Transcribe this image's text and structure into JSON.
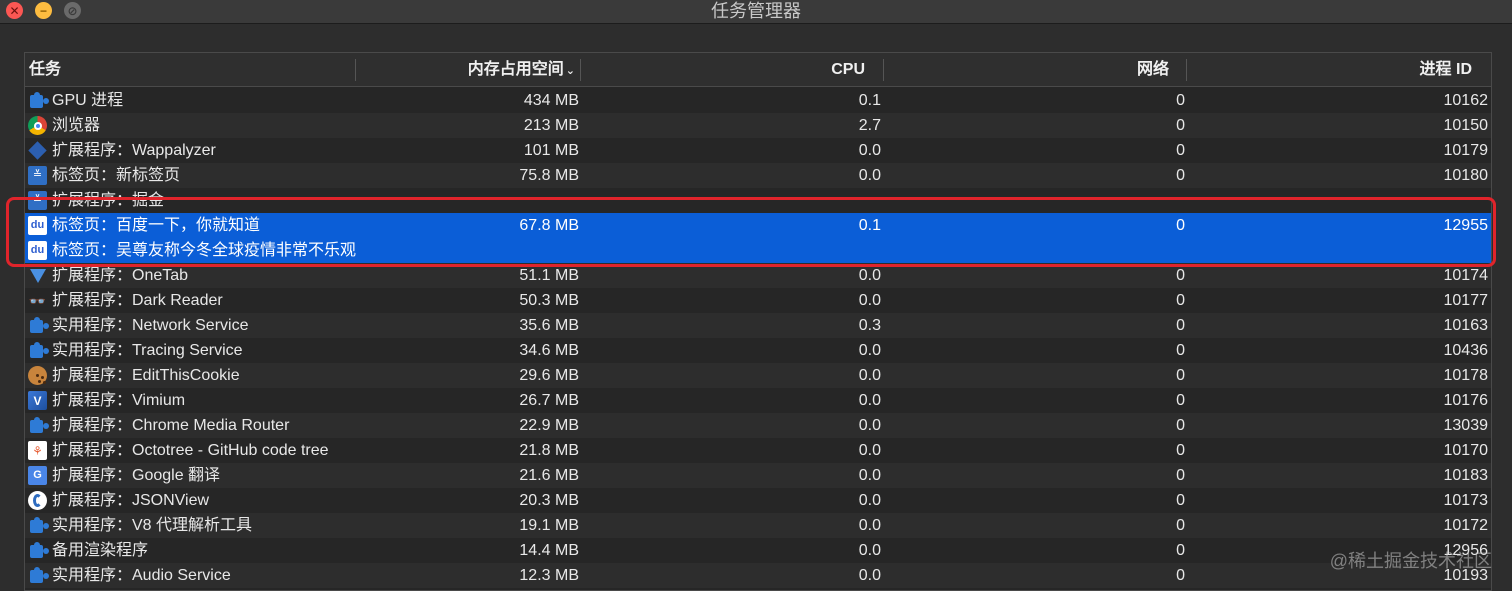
{
  "window": {
    "title": "任务管理器",
    "close_glyph": "✕",
    "minimize_glyph": "−",
    "zoom_glyph": "⊘"
  },
  "columns": {
    "task": "任务",
    "memory": "内存占用空间",
    "memory_sort_indicator": "⌄",
    "cpu": "CPU",
    "network": "网络",
    "pid": "进程 ID"
  },
  "rows": [
    {
      "icon": "puzzle-icon",
      "task": "GPU 进程",
      "memory": "434 MB",
      "cpu": "0.1",
      "network": "0",
      "pid": "10162"
    },
    {
      "icon": "chrome-icon",
      "task": "浏览器",
      "memory": "213 MB",
      "cpu": "2.7",
      "network": "0",
      "pid": "10150"
    },
    {
      "icon": "wappalyzer-icon",
      "task": "扩展程序：Wappalyzer",
      "memory": "101 MB",
      "cpu": "0.0",
      "network": "0",
      "pid": "10179"
    },
    {
      "icon": "new-tab-icon",
      "task": "标签页：新标签页",
      "memory": "75.8 MB",
      "cpu": "0.0",
      "network": "0",
      "pid": "10180"
    },
    {
      "icon": "juejin-icon",
      "task": "扩展程序：掘金",
      "memory": "",
      "cpu": "",
      "network": "",
      "pid": ""
    },
    {
      "icon": "baidu-icon",
      "task": "标签页：百度一下，你就知道",
      "task2": "标签页：吴尊友称今冬全球疫情非常不乐观",
      "memory": "67.8 MB",
      "cpu": "0.1",
      "network": "0",
      "pid": "12955"
    },
    {
      "icon": "onetab-icon",
      "task": "扩展程序：OneTab",
      "memory": "51.1 MB",
      "cpu": "0.0",
      "network": "0",
      "pid": "10174"
    },
    {
      "icon": "dark-reader-icon",
      "task": "扩展程序：Dark Reader",
      "memory": "50.3 MB",
      "cpu": "0.0",
      "network": "0",
      "pid": "10177"
    },
    {
      "icon": "puzzle-icon",
      "task": "实用程序：Network Service",
      "memory": "35.6 MB",
      "cpu": "0.3",
      "network": "0",
      "pid": "10163"
    },
    {
      "icon": "puzzle-icon",
      "task": "实用程序：Tracing Service",
      "memory": "34.6 MB",
      "cpu": "0.0",
      "network": "0",
      "pid": "10436"
    },
    {
      "icon": "cookie-icon",
      "task": "扩展程序：EditThisCookie",
      "memory": "29.6 MB",
      "cpu": "0.0",
      "network": "0",
      "pid": "10178"
    },
    {
      "icon": "vimium-icon",
      "task": "扩展程序：Vimium",
      "memory": "26.7 MB",
      "cpu": "0.0",
      "network": "0",
      "pid": "10176"
    },
    {
      "icon": "media-router-icon",
      "task": "扩展程序：Chrome Media Router",
      "memory": "22.9 MB",
      "cpu": "0.0",
      "network": "0",
      "pid": "13039"
    },
    {
      "icon": "octotree-icon",
      "task": "扩展程序：Octotree - GitHub code tree",
      "memory": "21.8 MB",
      "cpu": "0.0",
      "network": "0",
      "pid": "10170"
    },
    {
      "icon": "google-translate-icon",
      "task": "扩展程序：Google 翻译",
      "memory": "21.6 MB",
      "cpu": "0.0",
      "network": "0",
      "pid": "10183"
    },
    {
      "icon": "jsonview-icon",
      "task": "扩展程序：JSONView",
      "memory": "20.3 MB",
      "cpu": "0.0",
      "network": "0",
      "pid": "10173"
    },
    {
      "icon": "puzzle-icon",
      "task": "实用程序：V8 代理解析工具",
      "memory": "19.1 MB",
      "cpu": "0.0",
      "network": "0",
      "pid": "10172"
    },
    {
      "icon": "puzzle-icon",
      "task": "备用渲染程序",
      "memory": "14.4 MB",
      "cpu": "0.0",
      "network": "0",
      "pid": "12956"
    },
    {
      "icon": "puzzle-icon",
      "task": "实用程序：Audio Service",
      "memory": "12.3 MB",
      "cpu": "0.0",
      "network": "0",
      "pid": "10193"
    }
  ],
  "icon_glyphs": {
    "new_tab": "≚",
    "juejin": "≚",
    "baidu": "du",
    "dark_reader": "👓",
    "vimium": "V",
    "octotree": "⚘",
    "google_translate": "G"
  },
  "watermark": "@稀土掘金技术社区",
  "colors": {
    "selection": "#0b5ed7",
    "highlight_border": "#e0242b"
  }
}
